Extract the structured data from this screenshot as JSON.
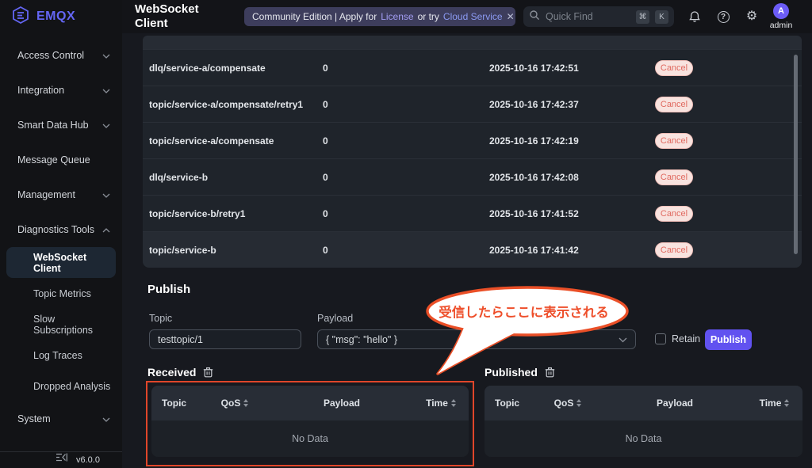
{
  "brand": {
    "name": "EMQX"
  },
  "page": {
    "title": "WebSocket Client"
  },
  "topbar": {
    "banner": {
      "prefix": "Community Edition | Apply for",
      "license_link": "License",
      "middle": "or try",
      "cloud_link": "Cloud Service",
      "close_icon": "✕"
    },
    "search": {
      "placeholder": "Quick Find",
      "cmd_key": "⌘",
      "k_key": "K"
    },
    "gear_icon": "⚙",
    "help_icon": "?",
    "user": {
      "initial": "A",
      "name": "admin"
    }
  },
  "sidebar": {
    "sections": [
      {
        "label": "Access Control"
      },
      {
        "label": "Integration"
      },
      {
        "label": "Smart Data Hub"
      },
      {
        "label": "Message Queue"
      },
      {
        "label": "Management"
      },
      {
        "label": "Diagnostics Tools"
      }
    ],
    "diagnostics_children": [
      {
        "label": "WebSocket Client"
      },
      {
        "label": "Topic Metrics"
      },
      {
        "label": "Slow Subscriptions"
      },
      {
        "label": "Log Traces"
      },
      {
        "label": "Dropped Analysis"
      }
    ],
    "system": {
      "label": "System"
    },
    "version": "v6.0.0"
  },
  "subscriptions": {
    "rows": [
      {
        "topic": "dlq/service-a/compensate",
        "qos": "0",
        "time": "2025-10-16 17:42:51",
        "action": "Cancel"
      },
      {
        "topic": "topic/service-a/compensate/retry1",
        "qos": "0",
        "time": "2025-10-16 17:42:37",
        "action": "Cancel"
      },
      {
        "topic": "topic/service-a/compensate",
        "qos": "0",
        "time": "2025-10-16 17:42:19",
        "action": "Cancel"
      },
      {
        "topic": "dlq/service-b",
        "qos": "0",
        "time": "2025-10-16 17:42:08",
        "action": "Cancel"
      },
      {
        "topic": "topic/service-b/retry1",
        "qos": "0",
        "time": "2025-10-16 17:41:52",
        "action": "Cancel"
      },
      {
        "topic": "topic/service-b",
        "qos": "0",
        "time": "2025-10-16 17:41:42",
        "action": "Cancel"
      }
    ]
  },
  "publish": {
    "heading": "Publish",
    "topic_label": "Topic",
    "topic_value": "testtopic/1",
    "payload_label": "Payload",
    "payload_value": "{ \"msg\": \"hello\" }",
    "retain_label": "Retain",
    "publish_button": "Publish"
  },
  "received": {
    "heading": "Received",
    "columns": [
      "Topic",
      "QoS",
      "Payload",
      "Time"
    ],
    "empty_text": "No Data"
  },
  "published": {
    "heading": "Published",
    "columns": [
      "Topic",
      "QoS",
      "Payload",
      "Time"
    ],
    "empty_text": "No Data"
  },
  "annotation": {
    "bubble_text": "受信したらここに表示される"
  },
  "colors": {
    "accent_purple": "#6152f0",
    "brand_purple": "#6466f4",
    "annotation_red": "#ea4f27",
    "cancel_red": "#e06a60",
    "active_item_bg": "#1d2733"
  }
}
